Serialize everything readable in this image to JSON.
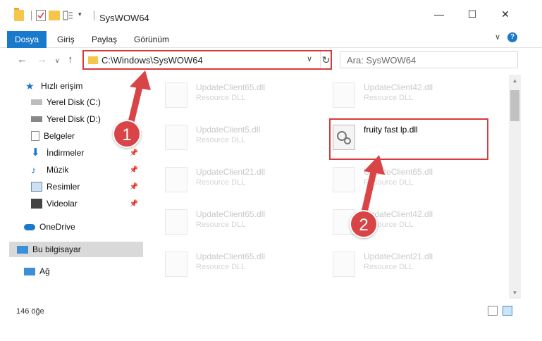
{
  "window": {
    "title": "SysWOW64",
    "minimize": "—",
    "maximize": "☐",
    "close": "✕"
  },
  "ribbon": {
    "tabs": [
      "Dosya",
      "Giriş",
      "Paylaş",
      "Görünüm"
    ],
    "help": "?"
  },
  "address": {
    "path": "C:\\Windows\\SysWOW64",
    "refresh": "↻"
  },
  "search": {
    "placeholder": "Ara: SysWOW64"
  },
  "sidebar": {
    "items": [
      {
        "label": "Hızlı erişim",
        "icon": "star-icon"
      },
      {
        "label": "Yerel Disk (C:)",
        "icon": "drive-icon"
      },
      {
        "label": "Yerel Disk (D:)",
        "icon": "drive-icon"
      },
      {
        "label": "Belgeler",
        "icon": "documents-icon"
      },
      {
        "label": "İndirmeler",
        "icon": "download-icon"
      },
      {
        "label": "Müzik",
        "icon": "music-icon"
      },
      {
        "label": "Resimler",
        "icon": "pictures-icon"
      },
      {
        "label": "Videolar",
        "icon": "videos-icon"
      },
      {
        "label": "OneDrive",
        "icon": "cloud-icon"
      },
      {
        "label": "Bu bilgisayar",
        "icon": "computer-icon"
      },
      {
        "label": "Ağ",
        "icon": "network-icon"
      }
    ]
  },
  "files": [
    {
      "name": "UpdateClient65.dll",
      "type": "Resource DLL"
    },
    {
      "name": "UpdateClient42.dll",
      "type": "Resource DLL"
    },
    {
      "name": "UpdateClient5.dll",
      "type": "Resource DLL"
    },
    {
      "name": "fruity fast lp.dll",
      "type": ""
    },
    {
      "name": "UpdateClient21.dll",
      "type": "Resource DLL"
    },
    {
      "name": "UpdateClient65.dll",
      "type": "Resource DLL"
    },
    {
      "name": "UpdateClient65.dll",
      "type": "Resource DLL"
    },
    {
      "name": "UpdateClient42.dll",
      "type": "Resource DLL"
    },
    {
      "name": "UpdateClient65.dll",
      "type": "Resource DLL"
    },
    {
      "name": "UpdateClient21.dll",
      "type": "Resource DLL"
    }
  ],
  "status": {
    "count": "146 öğe"
  },
  "callouts": {
    "one": "1",
    "two": "2"
  },
  "colors": {
    "accent": "#1979ca",
    "highlight": "#d9393a"
  }
}
